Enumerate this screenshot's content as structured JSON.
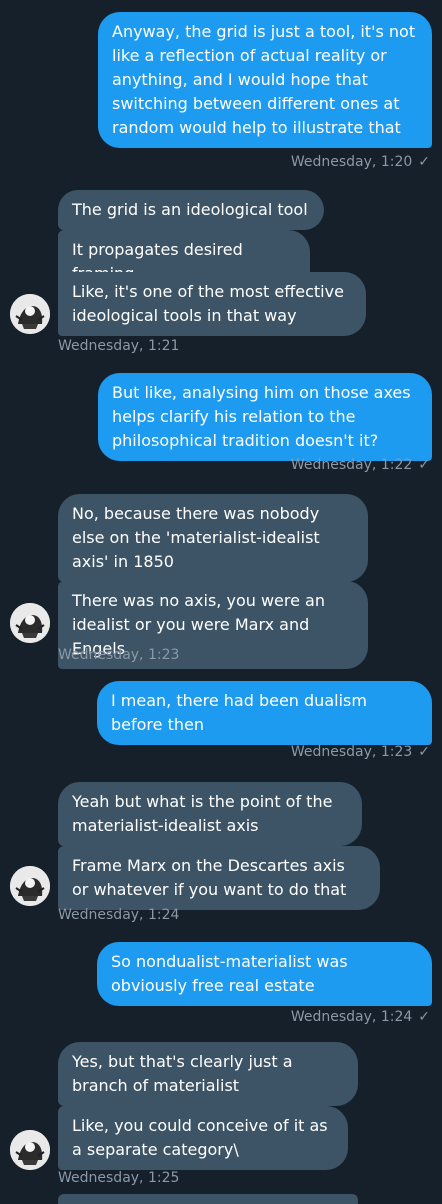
{
  "messages": [
    {
      "text": "Anyway, the grid is just a tool, it's not like a reflection of actual reality or anything, and I would hope that switching between different ones at random would help to illustrate that",
      "dir": "out"
    },
    {
      "text": "The grid is an ideological tool",
      "dir": "in"
    },
    {
      "text": "It propagates desired framing",
      "dir": "in"
    },
    {
      "text": "Like, it's one of the most effective ideological tools in that way",
      "dir": "in"
    },
    {
      "text": "But like, analysing him on those axes helps clarify his relation to the philosophical tradition doesn't it?",
      "dir": "out"
    },
    {
      "text": "No, because there was nobody else on the 'materialist-idealist axis' in 1850",
      "dir": "in"
    },
    {
      "text": "There was no axis, you were an idealist or you were Marx and Engels",
      "dir": "in"
    },
    {
      "text": "I mean, there had been dualism before then",
      "dir": "out"
    },
    {
      "text": "Yeah but what is the point of the materialist-idealist axis",
      "dir": "in"
    },
    {
      "text": "Frame Marx on the Descartes axis or whatever if you want to do that",
      "dir": "in"
    },
    {
      "text": "So nondualist-materialist was obviously free real estate",
      "dir": "out"
    },
    {
      "text": "Yes, but that's clearly just a branch of materialist",
      "dir": "in"
    },
    {
      "text": "Like, you could conceive of it as a separate category\\",
      "dir": "in"
    }
  ],
  "timestamps": [
    "Wednesday, 1:20",
    "Wednesday, 1:21",
    "Wednesday, 1:22",
    "Wednesday, 1:23",
    "Wednesday, 1:23",
    "Wednesday, 1:24",
    "Wednesday, 1:24",
    "Wednesday, 1:25"
  ],
  "icons": {
    "sent_check": "checkmark-icon",
    "avatar": "avatar"
  },
  "colors": {
    "background": "#15202b",
    "outgoing": "#1d9bf0",
    "incoming": "#3d5466",
    "meta": "#8b98a5"
  }
}
